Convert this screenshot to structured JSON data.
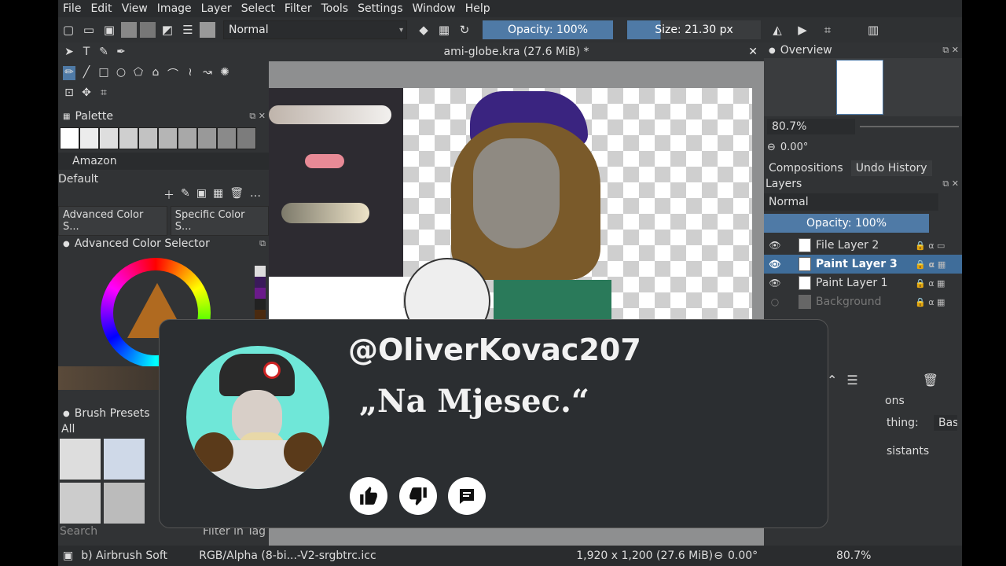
{
  "menu": [
    "File",
    "Edit",
    "View",
    "Image",
    "Layer",
    "Select",
    "Filter",
    "Tools",
    "Settings",
    "Window",
    "Help"
  ],
  "toolbar": {
    "blend_mode": "Normal",
    "opacity": "Opacity: 100%",
    "size": "Size: 21.30 px"
  },
  "document": {
    "tab_title": "ami-globe.kra (27.6 MiB) *"
  },
  "left_panel": {
    "palette_title": "Palette",
    "palette_name": "Amazon",
    "palette_set": "Default",
    "color_tabs": [
      "Advanced Color S...",
      "Specific Color S..."
    ],
    "color_selector_title": "Advanced Color Selector",
    "brush_presets_title": "Brush Presets",
    "brush_filter": "All",
    "search_placeholder": "Search",
    "filter_tag": "Filter in Tag"
  },
  "right_panel": {
    "overview_title": "Overview",
    "zoom": "80.7%",
    "rotation": "0.00°",
    "tabs": [
      "Compositions",
      "Undo History"
    ],
    "layers_title": "Layers",
    "layer_blend": "Normal",
    "layer_opacity": "Opacity:  100%",
    "layers": [
      {
        "name": "File Layer 2",
        "selected": false,
        "visible": true
      },
      {
        "name": "Paint Layer 3",
        "selected": true,
        "visible": true
      },
      {
        "name": "Paint Layer 1",
        "selected": false,
        "visible": true
      },
      {
        "name": "Background",
        "selected": false,
        "visible": false
      }
    ],
    "tool_options_fragment": "ons",
    "smoothing_label": "thing:",
    "smoothing_value": "Basic",
    "assistants_fragment": "sistants"
  },
  "statusbar": {
    "brush": "b) Airbrush Soft",
    "color_space": "RGB/Alpha (8-bi...-V2-srgbtrc.icc",
    "dimensions": "1,920 x 1,200 (27.6 MiB)",
    "rotation": "0.00°",
    "zoom": "80.7%"
  },
  "notification": {
    "handle": "@OliverKovac207",
    "quote": "„Na Mjesec.“",
    "buttons": [
      "thumbs-up",
      "thumbs-down",
      "comment"
    ]
  },
  "colors": {
    "accent": "#4f7aa6",
    "panel": "#313335",
    "avatar_bg": "#6fe7d8"
  }
}
